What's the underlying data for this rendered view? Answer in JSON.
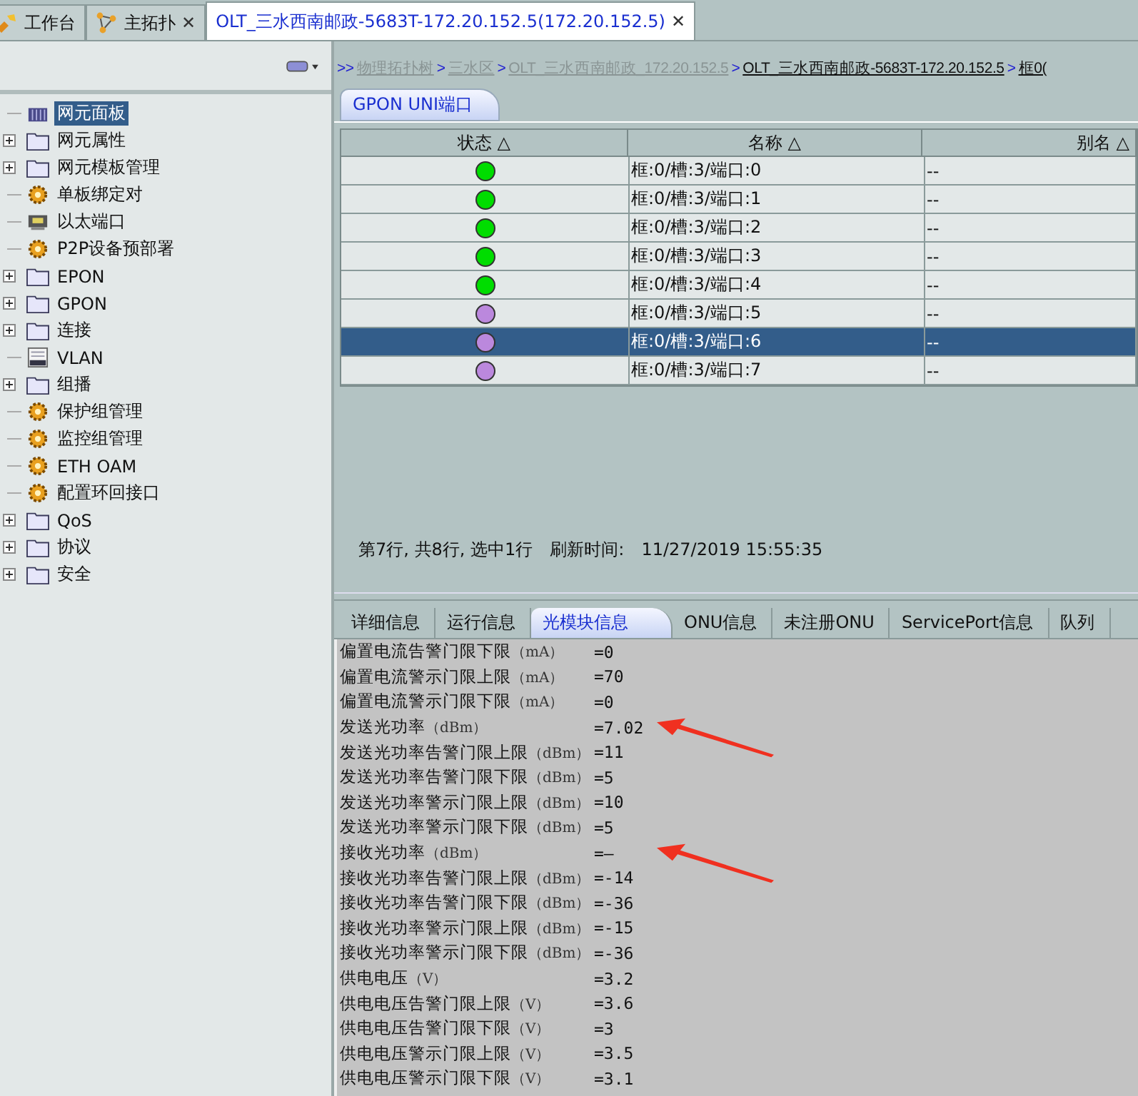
{
  "tabs": [
    {
      "label": "工作台",
      "selected": false,
      "closable": false
    },
    {
      "label": "主拓扑",
      "selected": false,
      "closable": true
    },
    {
      "label": "OLT_三水西南邮政-5683T-172.20.152.5(172.20.152.5)",
      "selected": true,
      "closable": true
    }
  ],
  "close_glyph": "✕",
  "tree": [
    {
      "label": "网元面板",
      "kind": "panel",
      "expandable": false,
      "selected": true
    },
    {
      "label": "网元属性",
      "kind": "folder",
      "expandable": true,
      "selected": false
    },
    {
      "label": "网元模板管理",
      "kind": "folder",
      "expandable": true,
      "selected": false
    },
    {
      "label": "单板绑定对",
      "kind": "gear",
      "expandable": false,
      "selected": false
    },
    {
      "label": "以太端口",
      "kind": "port",
      "expandable": false,
      "selected": false
    },
    {
      "label": "P2P设备预部署",
      "kind": "gear",
      "expandable": false,
      "selected": false
    },
    {
      "label": "EPON",
      "kind": "folder",
      "expandable": true,
      "selected": false
    },
    {
      "label": "GPON",
      "kind": "folder",
      "expandable": true,
      "selected": false
    },
    {
      "label": "连接",
      "kind": "folder",
      "expandable": true,
      "selected": false
    },
    {
      "label": "VLAN",
      "kind": "vlan",
      "expandable": false,
      "selected": false
    },
    {
      "label": "组播",
      "kind": "folder",
      "expandable": true,
      "selected": false
    },
    {
      "label": "保护组管理",
      "kind": "gear",
      "expandable": false,
      "selected": false
    },
    {
      "label": "监控组管理",
      "kind": "gear",
      "expandable": false,
      "selected": false
    },
    {
      "label": "ETH OAM",
      "kind": "gear",
      "expandable": false,
      "selected": false
    },
    {
      "label": "配置环回接口",
      "kind": "gear",
      "expandable": false,
      "selected": false
    },
    {
      "label": "QoS",
      "kind": "folder",
      "expandable": true,
      "selected": false
    },
    {
      "label": "协议",
      "kind": "folder",
      "expandable": true,
      "selected": false
    },
    {
      "label": "安全",
      "kind": "folder",
      "expandable": true,
      "selected": false
    }
  ],
  "breadcrumb": [
    {
      "kind": "sep",
      "text": ">>"
    },
    {
      "kind": "link",
      "text": "物理拓扑树",
      "current": false
    },
    {
      "kind": "sep",
      "text": ">"
    },
    {
      "kind": "link",
      "text": "三水区",
      "current": false
    },
    {
      "kind": "sep",
      "text": ">"
    },
    {
      "kind": "link",
      "text": "OLT_三水西南邮政_172.20.152.5",
      "current": false
    },
    {
      "kind": "sep",
      "text": ">"
    },
    {
      "kind": "link",
      "text": "OLT_三水西南邮政-5683T-172.20.152.5",
      "current": true
    },
    {
      "kind": "sep",
      "text": ">"
    },
    {
      "kind": "link",
      "text": "框0(",
      "current": true
    }
  ],
  "panel_tab": "GPON UNI端口",
  "table": {
    "columns": [
      "状态",
      "名称",
      "别名"
    ],
    "sort_glyph": "△",
    "rows": [
      {
        "color": "#00dd00",
        "name": "框:0/槽:3/端口:0",
        "alias": "--",
        "selected": false
      },
      {
        "color": "#00dd00",
        "name": "框:0/槽:3/端口:1",
        "alias": "--",
        "selected": false
      },
      {
        "color": "#00dd00",
        "name": "框:0/槽:3/端口:2",
        "alias": "--",
        "selected": false
      },
      {
        "color": "#00dd00",
        "name": "框:0/槽:3/端口:3",
        "alias": "--",
        "selected": false
      },
      {
        "color": "#00dd00",
        "name": "框:0/槽:3/端口:4",
        "alias": "--",
        "selected": false
      },
      {
        "color": "#bb88dd",
        "name": "框:0/槽:3/端口:5",
        "alias": "--",
        "selected": false
      },
      {
        "color": "#bb88dd",
        "name": "框:0/槽:3/端口:6",
        "alias": "--",
        "selected": true
      },
      {
        "color": "#bb88dd",
        "name": "框:0/槽:3/端口:7",
        "alias": "--",
        "selected": false
      }
    ]
  },
  "status": {
    "summary": "第7行, 共8行, 选中1行",
    "refresh_label": "刷新时间:",
    "refresh_time": "11/27/2019 15:55:35"
  },
  "detail_tabs": [
    {
      "label": "详细信息",
      "selected": false
    },
    {
      "label": "运行信息",
      "selected": false
    },
    {
      "label": "光模块信息",
      "selected": true
    },
    {
      "label": "ONU信息",
      "selected": false
    },
    {
      "label": "未注册ONU",
      "selected": false
    },
    {
      "label": "ServicePort信息",
      "selected": false
    },
    {
      "label": "队列",
      "selected": false
    }
  ],
  "properties": [
    {
      "label": "偏置电流告警门限下限",
      "unit": "（mA）",
      "value": "=0",
      "highlighted": false
    },
    {
      "label": "偏置电流警示门限上限",
      "unit": "（mA）",
      "value": "=70",
      "highlighted": false
    },
    {
      "label": "偏置电流警示门限下限",
      "unit": "（mA）",
      "value": "=0",
      "highlighted": false
    },
    {
      "label": "发送光功率",
      "unit": "（dBm）",
      "value": "=7.02",
      "highlighted": true
    },
    {
      "label": "发送光功率告警门限上限",
      "unit": "（dBm）",
      "value": "=11",
      "highlighted": false
    },
    {
      "label": "发送光功率告警门限下限",
      "unit": "（dBm）",
      "value": "=5",
      "highlighted": false
    },
    {
      "label": "发送光功率警示门限上限",
      "unit": "（dBm）",
      "value": "=10",
      "highlighted": false
    },
    {
      "label": "发送光功率警示门限下限",
      "unit": "（dBm）",
      "value": "=5",
      "highlighted": false
    },
    {
      "label": "接收光功率",
      "unit": "（dBm）",
      "value": "=—",
      "highlighted": true
    },
    {
      "label": "接收光功率告警门限上限",
      "unit": "（dBm）",
      "value": "=-14",
      "highlighted": false
    },
    {
      "label": "接收光功率告警门限下限",
      "unit": "（dBm）",
      "value": "=-36",
      "highlighted": false
    },
    {
      "label": "接收光功率警示门限上限",
      "unit": "（dBm）",
      "value": "=-15",
      "highlighted": false
    },
    {
      "label": "接收光功率警示门限下限",
      "unit": "（dBm）",
      "value": "=-36",
      "highlighted": false
    },
    {
      "label": "供电电压",
      "unit": "（V）",
      "value": "=3.2",
      "highlighted": false
    },
    {
      "label": "供电电压告警门限上限",
      "unit": "（V）",
      "value": "=3.6",
      "highlighted": false
    },
    {
      "label": "供电电压告警门限下限",
      "unit": "（V）",
      "value": "=3",
      "highlighted": false
    },
    {
      "label": "供电电压警示门限上限",
      "unit": "（V）",
      "value": "=3.5",
      "highlighted": false
    },
    {
      "label": "供电电压警示门限下限",
      "unit": "（V）",
      "value": "=3.1",
      "highlighted": false
    }
  ]
}
